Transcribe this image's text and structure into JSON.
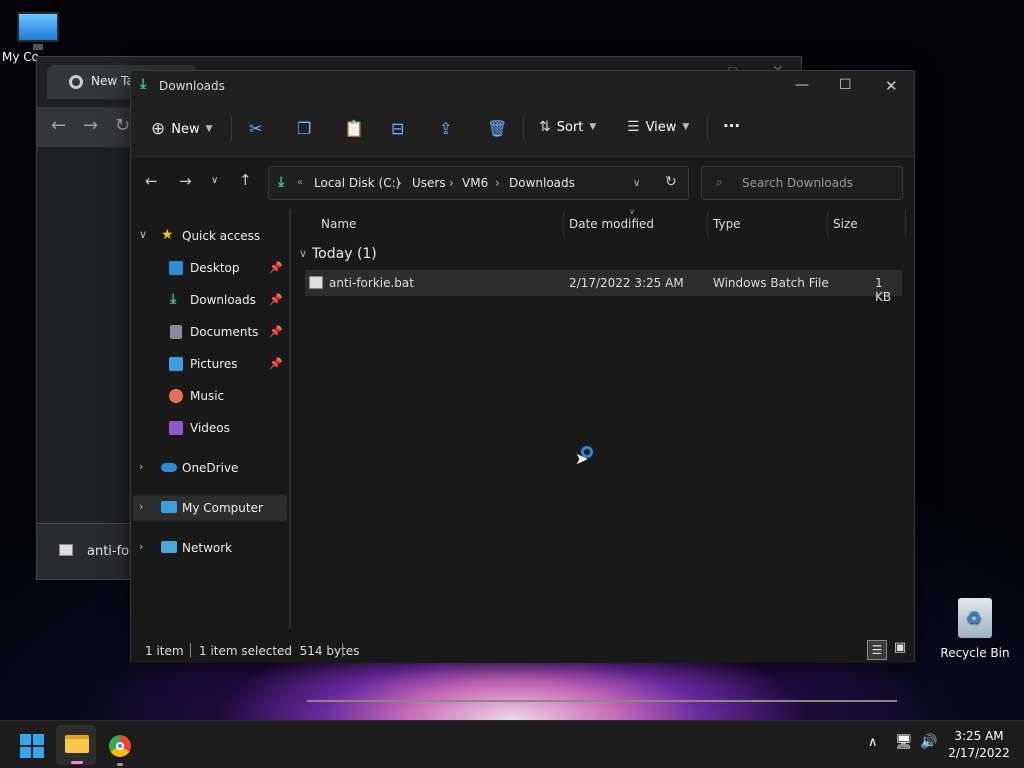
{
  "desktop": {
    "my_computer_label": "My Co",
    "recycle_bin_label": "Recycle Bin"
  },
  "chrome": {
    "tab_title": "New Tab",
    "download_item": "anti-for"
  },
  "explorer": {
    "title": "Downloads",
    "toolbar": {
      "new_label": "New",
      "sort_label": "Sort",
      "view_label": "View",
      "more_label": "···"
    },
    "address": {
      "overflow": "«",
      "crumbs": [
        "Local Disk (C:)",
        "Users",
        "VM6",
        "Downloads"
      ]
    },
    "search_placeholder": "Search Downloads",
    "nav": {
      "quick_access": "Quick access",
      "items": [
        {
          "label": "Desktop",
          "color": "#2b8fd6"
        },
        {
          "label": "Downloads",
          "color": "#3cc47c"
        },
        {
          "label": "Documents",
          "color": "#8a8a9a"
        },
        {
          "label": "Pictures",
          "color": "#3aa0e0"
        },
        {
          "label": "Music",
          "color": "#e8705a"
        },
        {
          "label": "Videos",
          "color": "#8a5ad0"
        }
      ],
      "onedrive": "OneDrive",
      "my_computer": "My Computer",
      "network": "Network"
    },
    "columns": [
      "Name",
      "Date modified",
      "Type",
      "Size"
    ],
    "group_header": "Today (1)",
    "files": [
      {
        "name": "anti-forkie.bat",
        "date": "2/17/2022 3:25 AM",
        "type": "Windows Batch File",
        "size": "1 KB"
      }
    ],
    "status": {
      "count": "1 item",
      "selected": "1 item selected  514 bytes"
    }
  },
  "taskbar": {
    "time": "3:25 AM",
    "date": "2/17/2022"
  }
}
